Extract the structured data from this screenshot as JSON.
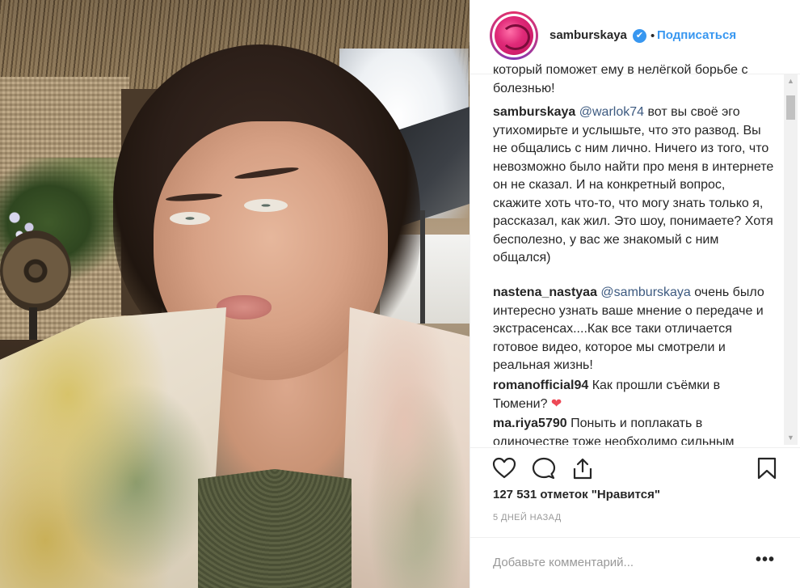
{
  "post": {
    "username": "samburskaya",
    "verified_icon": "✔",
    "separator": "•",
    "follow_label": "Подписаться"
  },
  "comments": [
    {
      "user": "",
      "mention": "",
      "text": "который поможет ему в нелёгкой борьбе с болезнью!"
    },
    {
      "user": "samburskaya",
      "mention": "@warlok74",
      "text": " вот вы своё эго утихомирьте и услышьте, что это развод. Вы не общались с ним лично. Ничего из того, что невозможно было найти про меня в интернете он не сказал. И на конкретный вопрос, скажите хоть что-то, что могу знать только я, рассказал, как жил. Это шоу, понимаете? Хотя бесполезно, у вас же знакомый с ним общался)"
    },
    {
      "user": "nastena_nastyaa",
      "mention": "@samburskaya",
      "text": " очень было интересно узнать ваше мнение о передаче и экстрасенсах....Как все таки отличается готовое видео, которое мы смотрели и реальная жизнь!"
    },
    {
      "user": "romanofficial94",
      "mention": "",
      "text": " Как прошли съёмки в Тюмени? ",
      "emoji": "❤"
    },
    {
      "user": "ma.riya5790",
      "mention": "",
      "text": " Поныть и поплакать в одиночестве тоже необходимо сильным"
    }
  ],
  "likes_text": "127 531 отметок \"Нравится\"",
  "date_text": "5 ДНЕЙ НАЗАД",
  "comment_input": {
    "placeholder": "Добавьте комментарий...",
    "value": ""
  },
  "more_label": "•••",
  "scrollbar": {
    "up": "▲",
    "down": "▼"
  },
  "icons": [
    "heart-icon",
    "comment-icon",
    "share-icon",
    "bookmark-icon"
  ],
  "colors": {
    "link": "#3897f0",
    "mention": "#3d5a80",
    "heart": "#ed4956"
  }
}
